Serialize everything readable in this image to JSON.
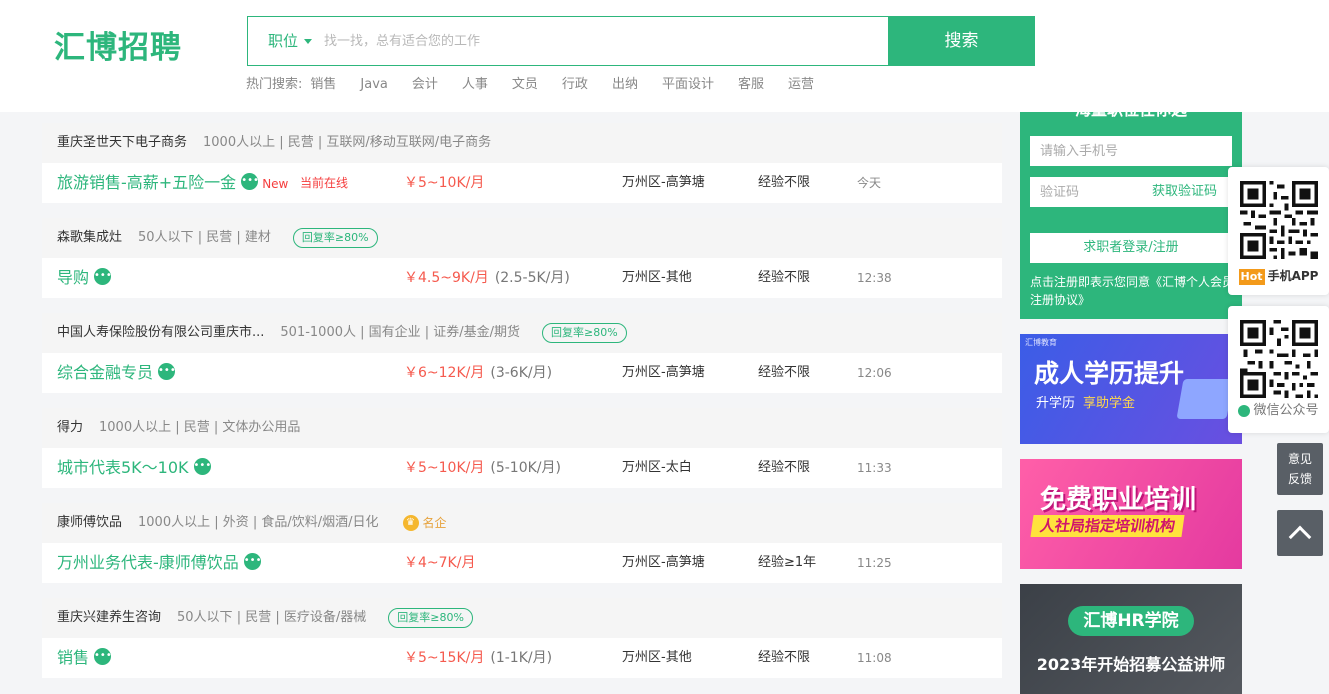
{
  "header": {
    "logo": "汇博招聘",
    "search": {
      "category": "职位",
      "placeholder": "找一找，总有适合您的工作",
      "button": "搜索"
    },
    "hot_label": "热门搜索:",
    "hot_keywords": [
      "销售",
      "Java",
      "会计",
      "人事",
      "文员",
      "行政",
      "出纳",
      "平面设计",
      "客服",
      "运营"
    ]
  },
  "jobs": [
    {
      "company": "重庆圣世天下电子商务",
      "company_info": "1000人以上 | 民营 | 互联网/移动互联网/电子商务",
      "badge": "",
      "title": "旅游销售-高薪+五险一金",
      "new_tag": "New",
      "online": "当前在线",
      "salary": "￥5~10K/月",
      "salary_sub": "",
      "location": "万州区-高笋塘",
      "experience": "经验不限",
      "time": "今天"
    },
    {
      "company": "森歌集成灶",
      "company_info": "50人以下 | 民营 | 建材",
      "badge": "回复率≥80%",
      "title": "导购",
      "new_tag": "",
      "online": "",
      "salary": "￥4.5~9K/月",
      "salary_sub": "(2.5-5K/月)",
      "location": "万州区-其他",
      "experience": "经验不限",
      "time": "12:38"
    },
    {
      "company": "中国人寿保险股份有限公司重庆市...",
      "company_info": "501-1000人 | 国有企业 | 证券/基金/期货",
      "badge": "回复率≥80%",
      "title": "综合金融专员",
      "new_tag": "",
      "online": "",
      "salary": "￥6~12K/月",
      "salary_sub": "(3-6K/月)",
      "location": "万州区-高笋塘",
      "experience": "经验不限",
      "time": "12:06"
    },
    {
      "company": "得力",
      "company_info": "1000人以上 | 民营 | 文体办公用品",
      "badge": "",
      "title": "城市代表5K～10K",
      "new_tag": "",
      "online": "",
      "salary": "￥5~10K/月",
      "salary_sub": "(5-10K/月)",
      "location": "万州区-太白",
      "experience": "经验不限",
      "time": "11:33"
    },
    {
      "company": "康师傅饮品",
      "company_info": "1000人以上 | 外资 | 食品/饮料/烟酒/日化",
      "badge": "",
      "famous": "名企",
      "title": "万州业务代表-康师傅饮品",
      "new_tag": "",
      "online": "",
      "salary": "￥4~7K/月",
      "salary_sub": "",
      "location": "万州区-高笋塘",
      "experience": "经验≥1年",
      "time": "11:25"
    },
    {
      "company": "重庆兴建养生咨询",
      "company_info": "50人以下 | 民营 | 医疗设备/器械",
      "badge": "回复率≥80%",
      "title": "销售",
      "new_tag": "",
      "online": "",
      "salary": "￥5~15K/月",
      "salary_sub": "(1-1K/月)",
      "location": "万州区-其他",
      "experience": "经验不限",
      "time": "11:08"
    }
  ],
  "login_panel": {
    "heading": "海量职位任你选",
    "phone_placeholder": "请输入手机号",
    "code_placeholder": "验证码",
    "get_code": "获取验证码",
    "login_button": "求职者登录/注册",
    "agreement": "点击注册即表示您同意《汇博个人会员注册协议》"
  },
  "banners": [
    {
      "small": "汇博教育",
      "title": "成人学历提升",
      "sub": "升学历",
      "highlight": "享助学金"
    },
    {
      "title": "免费职业培训",
      "sub": "人社局指定培训机构"
    },
    {
      "title": "汇博HR学院",
      "sub": "2023年开始招募公益讲师"
    }
  ],
  "qr": {
    "app_hot": "Hot",
    "app_label": "手机APP",
    "wechat_label": "微信公众号"
  },
  "feedback": [
    "意见",
    "反馈"
  ],
  "colors": {
    "brand": "#2db67c",
    "salary": "#f55a4e",
    "new": "#f53d3d"
  }
}
